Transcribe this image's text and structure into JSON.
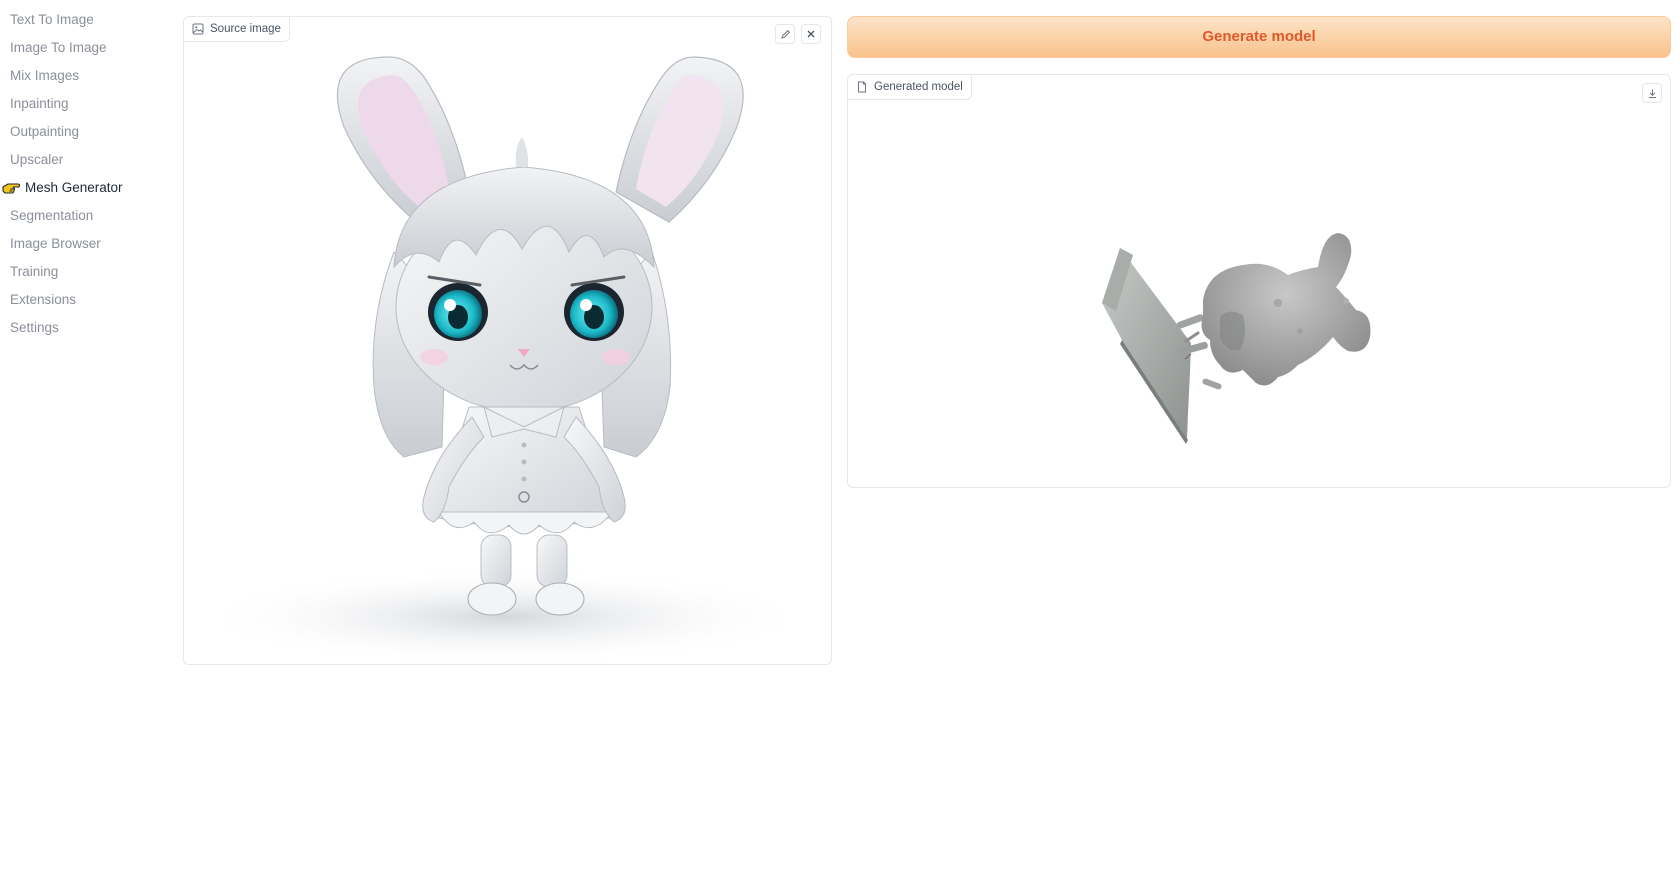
{
  "sidebar": {
    "items": [
      {
        "label": "Text To Image",
        "active": false
      },
      {
        "label": "Image To Image",
        "active": false
      },
      {
        "label": "Mix Images",
        "active": false
      },
      {
        "label": "Inpainting",
        "active": false
      },
      {
        "label": "Outpainting",
        "active": false
      },
      {
        "label": "Upscaler",
        "active": false
      },
      {
        "label": "Mesh Generator",
        "active": true,
        "icon": "pointing-hand-icon"
      },
      {
        "label": "Segmentation",
        "active": false
      },
      {
        "label": "Image Browser",
        "active": false
      },
      {
        "label": "Training",
        "active": false
      },
      {
        "label": "Extensions",
        "active": false
      },
      {
        "label": "Settings",
        "active": false
      }
    ]
  },
  "source": {
    "label": "Source image",
    "label_icon": "image-icon",
    "edit_icon": "pencil-icon",
    "close_icon": "close-icon"
  },
  "generate": {
    "label": "Generate model"
  },
  "model": {
    "label": "Generated model",
    "label_icon": "file-icon",
    "download_icon": "download-icon"
  },
  "colors": {
    "accent_text": "#e0592a",
    "button_gradient_top": "#fde4c8",
    "button_gradient_bottom": "#f9c28c",
    "nav_inactive": "#8a8f98",
    "nav_active": "#1f2937"
  }
}
